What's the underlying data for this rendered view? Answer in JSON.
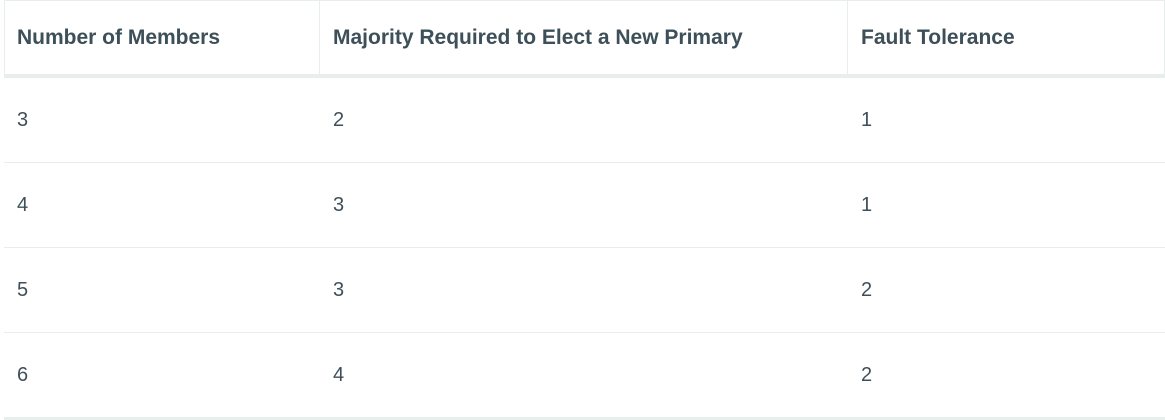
{
  "table": {
    "headers": [
      "Number of Members",
      "Majority Required to Elect a New Primary",
      "Fault Tolerance"
    ],
    "rows": [
      [
        "3",
        "2",
        "1"
      ],
      [
        "4",
        "3",
        "1"
      ],
      [
        "5",
        "3",
        "2"
      ],
      [
        "6",
        "4",
        "2"
      ]
    ]
  }
}
